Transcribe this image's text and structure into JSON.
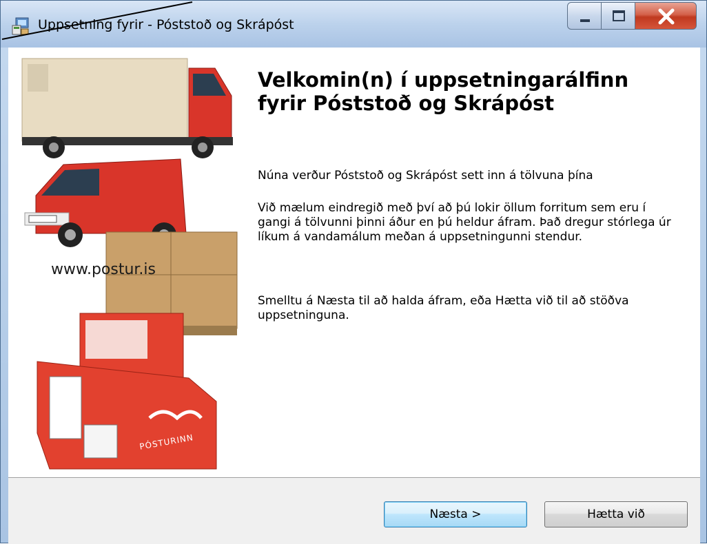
{
  "window": {
    "title": "Uppsetning fyrir - Póststoð og Skrápóst"
  },
  "sidebar": {
    "image_name": "delivery-vehicles-and-packages",
    "url": "www.postur.is",
    "logo_text": "PÓSTURINN"
  },
  "main": {
    "heading_line1": "Velkomin(n) í uppsetningarálfinn",
    "heading_line2": "fyrir Póststoð og Skrápóst",
    "paragraph1": "Núna verður Póststoð og Skrápóst sett inn á tölvuna þína",
    "paragraph2": "Við mælum eindregið með því að þú lokir öllum forritum sem eru í gangi á tölvunni þinni áður en þú heldur áfram. Það dregur stórlega úr líkum á vandamálum meðan á uppsetningunni stendur.",
    "paragraph3": "Smelltu á Næsta til að halda áfram, eða Hætta við til að stöðva uppsetninguna."
  },
  "footer": {
    "next_label": "Næsta >",
    "cancel_label": "Hætta við"
  },
  "colors": {
    "title_bar": "#bcd2ec",
    "close_button": "#c0391f",
    "postal_red": "#e2412f",
    "box_brown": "#c9a06a"
  }
}
